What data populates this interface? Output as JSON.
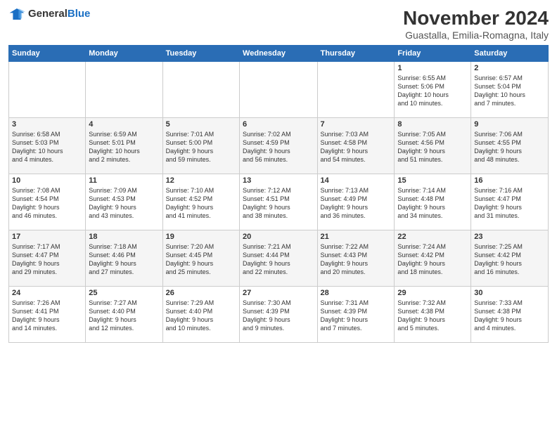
{
  "logo": {
    "general": "General",
    "blue": "Blue"
  },
  "title": "November 2024",
  "subtitle": "Guastalla, Emilia-Romagna, Italy",
  "weekdays": [
    "Sunday",
    "Monday",
    "Tuesday",
    "Wednesday",
    "Thursday",
    "Friday",
    "Saturday"
  ],
  "weeks": [
    [
      {
        "day": "",
        "info": ""
      },
      {
        "day": "",
        "info": ""
      },
      {
        "day": "",
        "info": ""
      },
      {
        "day": "",
        "info": ""
      },
      {
        "day": "",
        "info": ""
      },
      {
        "day": "1",
        "info": "Sunrise: 6:55 AM\nSunset: 5:06 PM\nDaylight: 10 hours\nand 10 minutes."
      },
      {
        "day": "2",
        "info": "Sunrise: 6:57 AM\nSunset: 5:04 PM\nDaylight: 10 hours\nand 7 minutes."
      }
    ],
    [
      {
        "day": "3",
        "info": "Sunrise: 6:58 AM\nSunset: 5:03 PM\nDaylight: 10 hours\nand 4 minutes."
      },
      {
        "day": "4",
        "info": "Sunrise: 6:59 AM\nSunset: 5:01 PM\nDaylight: 10 hours\nand 2 minutes."
      },
      {
        "day": "5",
        "info": "Sunrise: 7:01 AM\nSunset: 5:00 PM\nDaylight: 9 hours\nand 59 minutes."
      },
      {
        "day": "6",
        "info": "Sunrise: 7:02 AM\nSunset: 4:59 PM\nDaylight: 9 hours\nand 56 minutes."
      },
      {
        "day": "7",
        "info": "Sunrise: 7:03 AM\nSunset: 4:58 PM\nDaylight: 9 hours\nand 54 minutes."
      },
      {
        "day": "8",
        "info": "Sunrise: 7:05 AM\nSunset: 4:56 PM\nDaylight: 9 hours\nand 51 minutes."
      },
      {
        "day": "9",
        "info": "Sunrise: 7:06 AM\nSunset: 4:55 PM\nDaylight: 9 hours\nand 48 minutes."
      }
    ],
    [
      {
        "day": "10",
        "info": "Sunrise: 7:08 AM\nSunset: 4:54 PM\nDaylight: 9 hours\nand 46 minutes."
      },
      {
        "day": "11",
        "info": "Sunrise: 7:09 AM\nSunset: 4:53 PM\nDaylight: 9 hours\nand 43 minutes."
      },
      {
        "day": "12",
        "info": "Sunrise: 7:10 AM\nSunset: 4:52 PM\nDaylight: 9 hours\nand 41 minutes."
      },
      {
        "day": "13",
        "info": "Sunrise: 7:12 AM\nSunset: 4:51 PM\nDaylight: 9 hours\nand 38 minutes."
      },
      {
        "day": "14",
        "info": "Sunrise: 7:13 AM\nSunset: 4:49 PM\nDaylight: 9 hours\nand 36 minutes."
      },
      {
        "day": "15",
        "info": "Sunrise: 7:14 AM\nSunset: 4:48 PM\nDaylight: 9 hours\nand 34 minutes."
      },
      {
        "day": "16",
        "info": "Sunrise: 7:16 AM\nSunset: 4:47 PM\nDaylight: 9 hours\nand 31 minutes."
      }
    ],
    [
      {
        "day": "17",
        "info": "Sunrise: 7:17 AM\nSunset: 4:47 PM\nDaylight: 9 hours\nand 29 minutes."
      },
      {
        "day": "18",
        "info": "Sunrise: 7:18 AM\nSunset: 4:46 PM\nDaylight: 9 hours\nand 27 minutes."
      },
      {
        "day": "19",
        "info": "Sunrise: 7:20 AM\nSunset: 4:45 PM\nDaylight: 9 hours\nand 25 minutes."
      },
      {
        "day": "20",
        "info": "Sunrise: 7:21 AM\nSunset: 4:44 PM\nDaylight: 9 hours\nand 22 minutes."
      },
      {
        "day": "21",
        "info": "Sunrise: 7:22 AM\nSunset: 4:43 PM\nDaylight: 9 hours\nand 20 minutes."
      },
      {
        "day": "22",
        "info": "Sunrise: 7:24 AM\nSunset: 4:42 PM\nDaylight: 9 hours\nand 18 minutes."
      },
      {
        "day": "23",
        "info": "Sunrise: 7:25 AM\nSunset: 4:42 PM\nDaylight: 9 hours\nand 16 minutes."
      }
    ],
    [
      {
        "day": "24",
        "info": "Sunrise: 7:26 AM\nSunset: 4:41 PM\nDaylight: 9 hours\nand 14 minutes."
      },
      {
        "day": "25",
        "info": "Sunrise: 7:27 AM\nSunset: 4:40 PM\nDaylight: 9 hours\nand 12 minutes."
      },
      {
        "day": "26",
        "info": "Sunrise: 7:29 AM\nSunset: 4:40 PM\nDaylight: 9 hours\nand 10 minutes."
      },
      {
        "day": "27",
        "info": "Sunrise: 7:30 AM\nSunset: 4:39 PM\nDaylight: 9 hours\nand 9 minutes."
      },
      {
        "day": "28",
        "info": "Sunrise: 7:31 AM\nSunset: 4:39 PM\nDaylight: 9 hours\nand 7 minutes."
      },
      {
        "day": "29",
        "info": "Sunrise: 7:32 AM\nSunset: 4:38 PM\nDaylight: 9 hours\nand 5 minutes."
      },
      {
        "day": "30",
        "info": "Sunrise: 7:33 AM\nSunset: 4:38 PM\nDaylight: 9 hours\nand 4 minutes."
      }
    ]
  ]
}
